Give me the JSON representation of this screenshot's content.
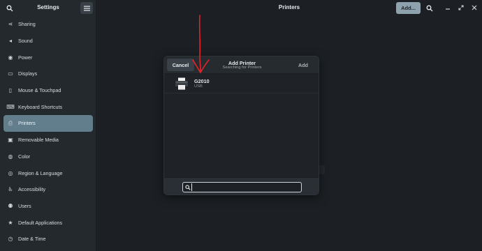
{
  "sidebar": {
    "title": "Settings",
    "search_icon": "search-icon",
    "menu_icon": "hamburger-menu-icon",
    "items": [
      {
        "label": "Sharing",
        "icon": "share-icon",
        "glyph": "⋖"
      },
      {
        "label": "Sound",
        "icon": "speaker-icon",
        "glyph": "◂"
      },
      {
        "label": "Power",
        "icon": "power-icon",
        "glyph": "◉"
      },
      {
        "label": "Displays",
        "icon": "display-icon",
        "glyph": "▭"
      },
      {
        "label": "Mouse & Touchpad",
        "icon": "mouse-icon",
        "glyph": "▯"
      },
      {
        "label": "Keyboard Shortcuts",
        "icon": "keyboard-icon",
        "glyph": "⌨"
      },
      {
        "label": "Printers",
        "icon": "printer-icon",
        "glyph": "⎙",
        "active": true
      },
      {
        "label": "Removable Media",
        "icon": "removable-media-icon",
        "glyph": "▣"
      },
      {
        "label": "Color",
        "icon": "color-icon",
        "glyph": "◍"
      },
      {
        "label": "Region & Language",
        "icon": "globe-icon",
        "glyph": "◎"
      },
      {
        "label": "Accessibility",
        "icon": "accessibility-icon",
        "glyph": "♿"
      },
      {
        "label": "Users",
        "icon": "users-icon",
        "glyph": "⚉"
      },
      {
        "label": "Default Applications",
        "icon": "star-icon",
        "glyph": "★"
      },
      {
        "label": "Date & Time",
        "icon": "clock-icon",
        "glyph": "◷"
      }
    ]
  },
  "header": {
    "title": "Printers",
    "add_label": "Add...",
    "search_icon": "search-icon",
    "minimize_icon": "minimize-icon",
    "maximize_icon": "maximize-icon",
    "close_icon": "close-icon"
  },
  "dialog": {
    "title": "Add Printer",
    "subtitle": "Searching for Printers",
    "cancel_label": "Cancel",
    "add_label": "Add",
    "printers": [
      {
        "name": "G2010",
        "connection": "USB"
      }
    ],
    "search": {
      "value": "",
      "placeholder": ""
    }
  },
  "colors": {
    "accent": "#627d8c",
    "annotation_arrow": "#e4232a"
  }
}
